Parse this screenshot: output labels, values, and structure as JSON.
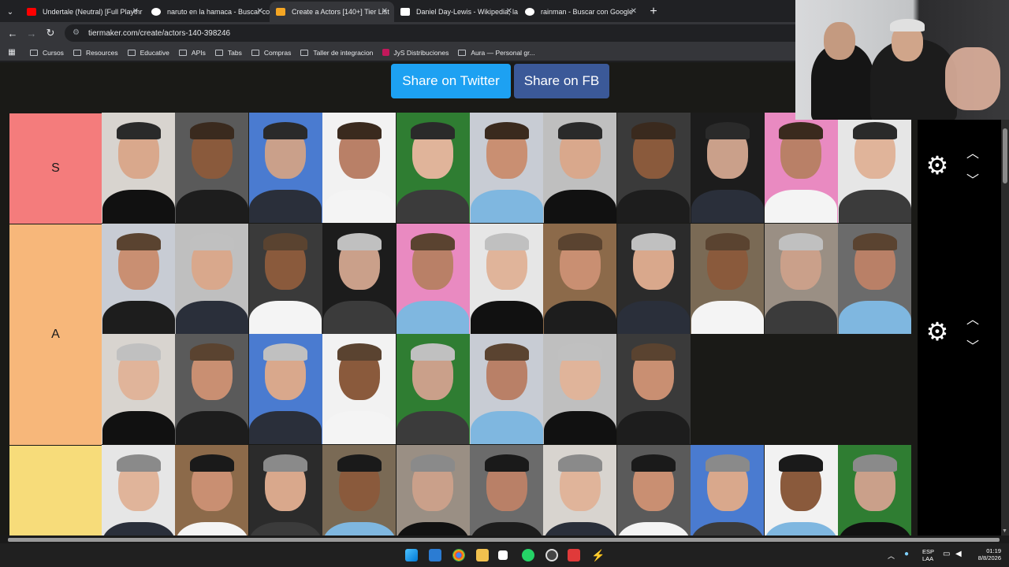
{
  "browser": {
    "tabs": [
      {
        "title": "Undertale (Neutral) [Full Playthr",
        "favicon_color": "#ff0000"
      },
      {
        "title": "naruto en la hamaca - Buscar co",
        "favicon_color": "#ffffff"
      },
      {
        "title": "Create a Actors [140+] Tier List",
        "favicon_color": "#f5a623",
        "active": true
      },
      {
        "title": "Daniel Day-Lewis - Wikipedia, la",
        "favicon_color": "#ffffff"
      },
      {
        "title": "rainman - Buscar con Google",
        "favicon_color": "#ffffff"
      }
    ],
    "url": "tiermaker.com/create/actors-140-398246",
    "bookmarks": [
      "Cursos",
      "Resources",
      "Educative",
      "APIs",
      "Tabs",
      "Compras",
      "Taller de integracion",
      "JyS Distribuciones",
      "Aura — Personal gr..."
    ]
  },
  "page": {
    "share_twitter": "Share on Twitter",
    "share_fb": "Share on FB",
    "tiers": [
      {
        "label": "S",
        "color": "#f47c7c",
        "count": 11
      },
      {
        "label": "A",
        "color": "#f7b77a",
        "count": 19
      },
      {
        "label": "",
        "color": "#f7dc7a",
        "count": 11
      }
    ]
  },
  "taskbar": {
    "lang": "ESP",
    "lang2": "LAA",
    "time": "01:19",
    "date": "8/8/2026"
  }
}
